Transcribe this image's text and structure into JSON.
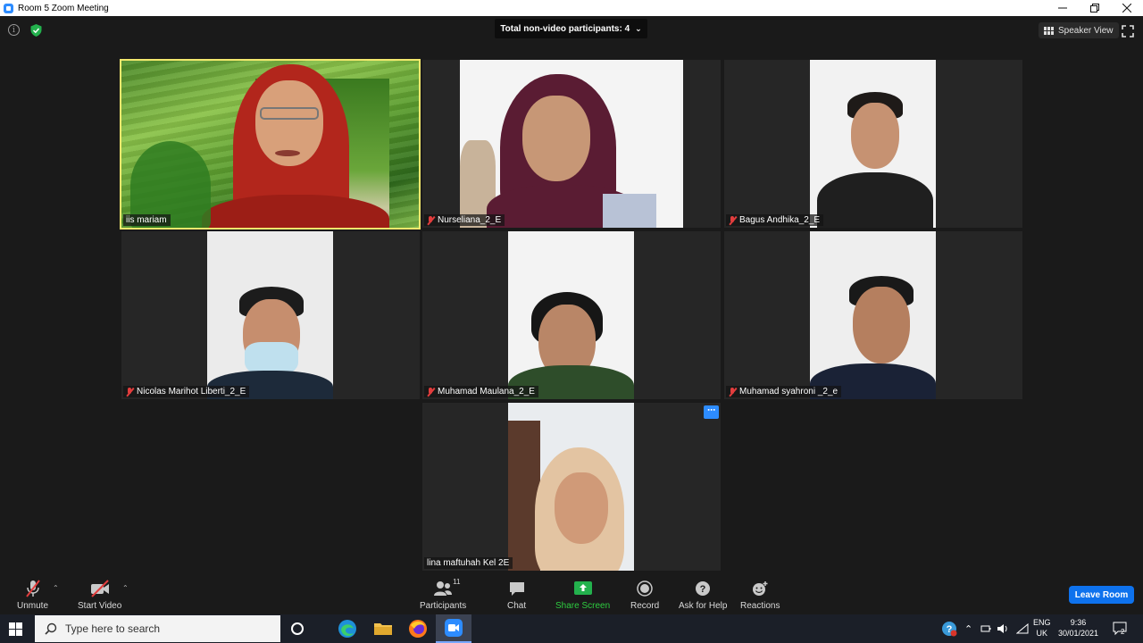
{
  "window": {
    "title": "Room 5   Zoom Meeting",
    "controls": [
      "minimize-icon",
      "restore-icon",
      "close-icon"
    ]
  },
  "meeting": {
    "banner": "Total non-video participants: 4",
    "view_label": "Speaker View"
  },
  "participants": [
    {
      "name": "iis mariam",
      "muted": false,
      "active": true
    },
    {
      "name": "Nurseliana_2_E",
      "muted": true
    },
    {
      "name": "Bagus Andhika_2_E",
      "muted": true
    },
    {
      "name": "Nicolas Marihot Liberti_2_E",
      "muted": true
    },
    {
      "name": "Muhamad Maulana_2_E",
      "muted": true
    },
    {
      "name": "Muhamad syahroni _2_e",
      "muted": true
    },
    {
      "name": "lina maftuhah Kel 2E",
      "muted": false
    }
  ],
  "toolbar": {
    "unmute": "Unmute",
    "start_video": "Start Video",
    "participants": "Participants",
    "participants_count": "11",
    "chat": "Chat",
    "share_screen": "Share Screen",
    "record": "Record",
    "ask_for_help": "Ask for Help",
    "reactions": "Reactions",
    "leave": "Leave Room"
  },
  "taskbar": {
    "search_placeholder": "Type here to search",
    "lang_top": "ENG",
    "lang_bottom": "UK",
    "time": "9:36",
    "date": "30/01/2021",
    "notification_count": "2"
  },
  "colors": {
    "active_speaker_border": "#f2e86d",
    "accent_blue": "#0e72ed",
    "share_green": "#2ecc40",
    "muted_red": "#e23d3d"
  }
}
